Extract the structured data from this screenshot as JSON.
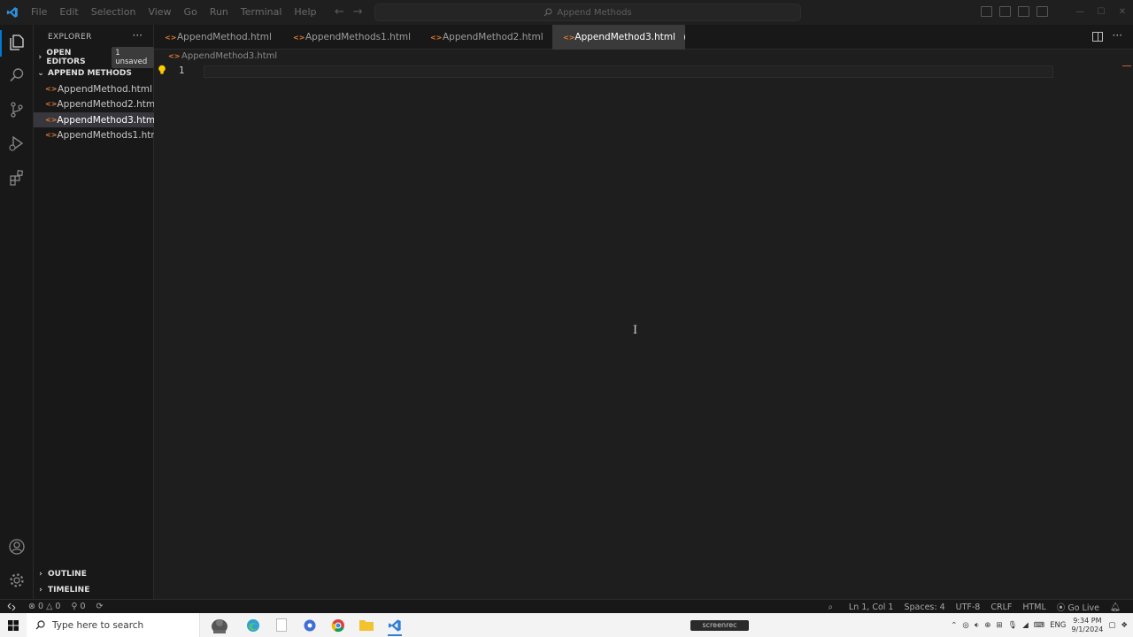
{
  "menu": [
    "File",
    "Edit",
    "Selection",
    "View",
    "Go",
    "Run",
    "Terminal",
    "Help"
  ],
  "command_center": {
    "text": "Append Methods"
  },
  "explorer": {
    "title": "EXPLORER",
    "open_editors": {
      "label": "OPEN EDITORS",
      "badge": "1 unsaved"
    },
    "folder": {
      "label": "APPEND METHODS"
    },
    "files": [
      "AppendMethod.html",
      "AppendMethod2.html",
      "AppendMethod3.html",
      "AppendMethods1.html"
    ],
    "selected_file": "AppendMethod3.html",
    "outline": "OUTLINE",
    "timeline": "TIMELINE"
  },
  "tabs": [
    {
      "label": "AppendMethod.html",
      "active": false
    },
    {
      "label": "AppendMethods1.html",
      "active": false
    },
    {
      "label": "AppendMethod2.html",
      "active": false
    },
    {
      "label": "AppendMethod3.html",
      "active": true,
      "dirty": true
    }
  ],
  "breadcrumb": "AppendMethod3.html",
  "editor": {
    "line_numbers": [
      "1"
    ]
  },
  "statusbar": {
    "errors": "0",
    "warnings": "0",
    "ports": "0",
    "position": "Ln 1, Col 1",
    "spaces": "Spaces: 4",
    "encoding": "UTF-8",
    "eol": "CRLF",
    "language": "HTML",
    "go_live": "Go Live"
  },
  "taskbar": {
    "search_placeholder": "Type here to search",
    "language": "ENG",
    "time": "9:34 PM",
    "date": "9/1/2024",
    "watermark": "screenrec"
  },
  "colors": {
    "accent": "#0078d4",
    "html_icon": "#e37933",
    "background": "#1e1e1e"
  }
}
